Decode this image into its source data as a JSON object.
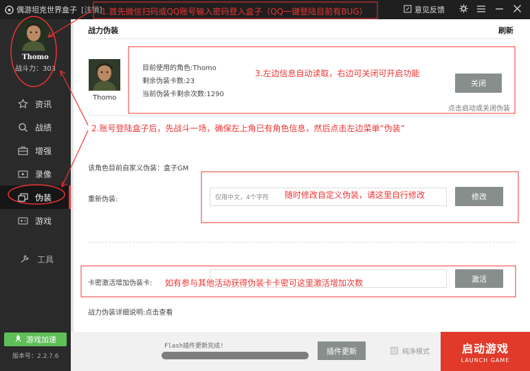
{
  "titlebar": {
    "title": "偶游坦克世界盒子",
    "logout": "[注销]",
    "feedback": "意见反馈"
  },
  "sidebar": {
    "user_name": "Thomo",
    "power": "战斗力：303",
    "items": [
      {
        "label": "资讯",
        "icon": "star-icon"
      },
      {
        "label": "战绩",
        "icon": "search-icon"
      },
      {
        "label": "增强",
        "icon": "toolbox-icon"
      },
      {
        "label": "录像",
        "icon": "video-icon"
      },
      {
        "label": "伪装",
        "icon": "layers-icon"
      },
      {
        "label": "游戏",
        "icon": "gamepad-icon"
      }
    ],
    "active": "伪装",
    "tools": "工具",
    "accel": "游戏加速",
    "version": "版本号：2.2.7.6"
  },
  "main": {
    "section_title": "战力伪装",
    "refresh": "刷新",
    "char_name": "Thomo",
    "current_role": "目前使用的角色:Thomo",
    "remaining_cards": "剩余伪装卡数:23",
    "remaining_times": "当前伪装卡剩余次数:1290",
    "close_btn": "关闭",
    "toggle_hint": "点击启动或关闭伪装",
    "custom_label": "该角色目前自家义伪装：盒子GM",
    "rename_label": "重新伪装:",
    "rename_placeholder": "仅限中文，4个字符",
    "modify_btn": "修改",
    "card_label": "卡密激活增加伪装卡:",
    "activate_btn": "激活",
    "detail_link": "战力伪装详细说明:点击查看"
  },
  "bottom": {
    "flash_status": "Flash插件更新完成!",
    "progress": 1.0,
    "plugin_btn": "插件更新",
    "pure_mode": "纯净模式",
    "launch_main": "启动游戏",
    "launch_sub": "LAUNCH GAME"
  },
  "annotations": {
    "a1": "1.首先微信扫码或QQ账号输入密码登入盒子（QQ一键登陆目前有BUG）",
    "a2": "2.账号登陆盒子后，先战斗一场，确保左上角已有角色信息，然后点击左边菜单“伪装”",
    "a3": "3.左边信息自动读取，右边可关闭可开启功能",
    "a4": "随时修改自定义伪装，请这里自行修改",
    "a5": "如有参与其他活动获得伪装卡卡密可这里激活增加次数"
  },
  "colors": {
    "accent_red": "#e23b3b",
    "launch_red": "#e13a2a",
    "accel_green": "#5fbf57",
    "button_gray": "#888e8b"
  }
}
